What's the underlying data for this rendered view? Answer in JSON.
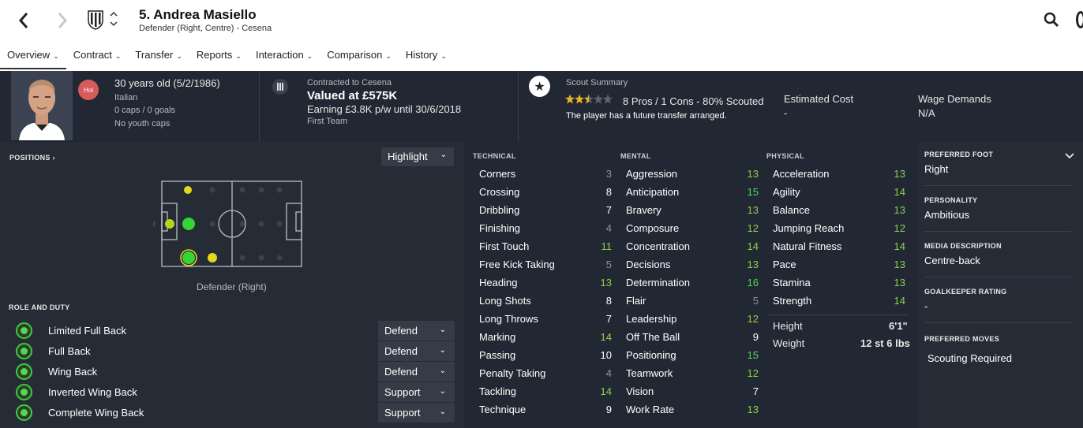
{
  "header": {
    "player_name": "5. Andrea Masiello",
    "subtitle": "Defender (Right, Centre) - Cesena",
    "icons": [
      "back-arrow-icon",
      "forward-arrow-icon",
      "club-crest-icon",
      "search-icon"
    ]
  },
  "menu": [
    {
      "label": "Overview"
    },
    {
      "label": "Contract"
    },
    {
      "label": "Transfer"
    },
    {
      "label": "Reports"
    },
    {
      "label": "Interaction"
    },
    {
      "label": "Comparison"
    },
    {
      "label": "History"
    }
  ],
  "info": {
    "hol_badge": "Hol",
    "age": "30 years old (5/2/1986)",
    "nationality": "Italian",
    "caps": "0 caps / 0 goals",
    "youth_caps": "No youth caps",
    "contract_label": "Contracted to Cesena",
    "value": "Valued at £575K",
    "earning": "Earning £3.8K p/w until 30/6/2018",
    "squad": "First Team",
    "scout_label": "Scout Summary",
    "scout_stars": 2.5,
    "scout_line": "8 Pros / 1 Cons - 80% Scouted",
    "scout_note": "The player has a future transfer arranged.",
    "est_cost_label": "Estimated Cost",
    "est_cost_value": "-",
    "wage_label": "Wage Demands",
    "wage_value": "N/A"
  },
  "positions": {
    "label": "POSITIONS",
    "highlight": "Highlight",
    "position_name": "Defender (Right)"
  },
  "roles": {
    "label": "ROLE AND DUTY",
    "items": [
      {
        "name": "Limited Full Back",
        "duty": "Defend"
      },
      {
        "name": "Full Back",
        "duty": "Defend"
      },
      {
        "name": "Wing Back",
        "duty": "Defend"
      },
      {
        "name": "Inverted Wing Back",
        "duty": "Support"
      },
      {
        "name": "Complete Wing Back",
        "duty": "Support"
      }
    ]
  },
  "attributes": {
    "technical_label": "TECHNICAL",
    "mental_label": "MENTAL",
    "physical_label": "PHYSICAL",
    "technical": [
      {
        "name": "Corners",
        "value": "3"
      },
      {
        "name": "Crossing",
        "value": "8"
      },
      {
        "name": "Dribbling",
        "value": "7"
      },
      {
        "name": "Finishing",
        "value": "4"
      },
      {
        "name": "First Touch",
        "value": "11"
      },
      {
        "name": "Free Kick Taking",
        "value": "5"
      },
      {
        "name": "Heading",
        "value": "13"
      },
      {
        "name": "Long Shots",
        "value": "8"
      },
      {
        "name": "Long Throws",
        "value": "7"
      },
      {
        "name": "Marking",
        "value": "14"
      },
      {
        "name": "Passing",
        "value": "10"
      },
      {
        "name": "Penalty Taking",
        "value": "4"
      },
      {
        "name": "Tackling",
        "value": "14"
      },
      {
        "name": "Technique",
        "value": "9"
      }
    ],
    "mental": [
      {
        "name": "Aggression",
        "value": "13"
      },
      {
        "name": "Anticipation",
        "value": "15"
      },
      {
        "name": "Bravery",
        "value": "13"
      },
      {
        "name": "Composure",
        "value": "12"
      },
      {
        "name": "Concentration",
        "value": "14"
      },
      {
        "name": "Decisions",
        "value": "13"
      },
      {
        "name": "Determination",
        "value": "16"
      },
      {
        "name": "Flair",
        "value": "5"
      },
      {
        "name": "Leadership",
        "value": "12"
      },
      {
        "name": "Off The Ball",
        "value": "9"
      },
      {
        "name": "Positioning",
        "value": "15"
      },
      {
        "name": "Teamwork",
        "value": "12"
      },
      {
        "name": "Vision",
        "value": "7"
      },
      {
        "name": "Work Rate",
        "value": "13"
      }
    ],
    "physical": [
      {
        "name": "Acceleration",
        "value": "13"
      },
      {
        "name": "Agility",
        "value": "14"
      },
      {
        "name": "Balance",
        "value": "13"
      },
      {
        "name": "Jumping Reach",
        "value": "12"
      },
      {
        "name": "Natural Fitness",
        "value": "14"
      },
      {
        "name": "Pace",
        "value": "13"
      },
      {
        "name": "Stamina",
        "value": "13"
      },
      {
        "name": "Strength",
        "value": "14"
      }
    ],
    "height_label": "Height",
    "height_value": "6'1\"",
    "weight_label": "Weight",
    "weight_value": "12 st 6 lbs"
  },
  "colors": {
    "low": "#8d939c",
    "mid": "#ffffff",
    "good": "#8ed14a",
    "high": "#4fd94f"
  },
  "profile": {
    "foot_label": "PREFERRED FOOT",
    "foot_value": "Right",
    "personality_label": "PERSONALITY",
    "personality_value": "Ambitious",
    "media_label": "MEDIA DESCRIPTION",
    "media_value": "Centre-back",
    "gk_label": "GOALKEEPER RATING",
    "gk_value": "-",
    "moves_label": "PREFERRED MOVES",
    "moves_value": "Scouting Required"
  }
}
